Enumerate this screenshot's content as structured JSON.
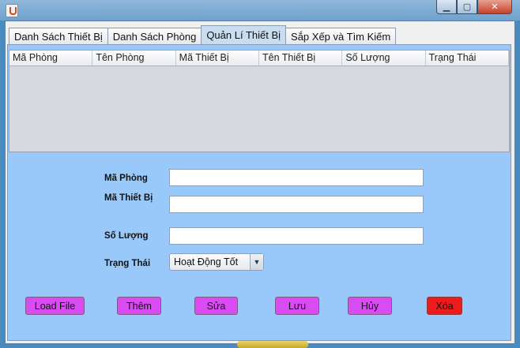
{
  "window": {
    "minimize_icon": "minimize-icon",
    "maximize_icon": "maximize-icon",
    "close_icon": "close-icon"
  },
  "tabs": [
    {
      "label": "Danh Sách Thiết Bị"
    },
    {
      "label": "Danh Sách Phòng"
    },
    {
      "label": "Quản Lí Thiết Bị"
    },
    {
      "label": "Sắp Xếp và Tìm Kiếm"
    }
  ],
  "table": {
    "columns": [
      "Mã Phòng",
      "Tên Phòng",
      "Mã Thiết Bị",
      "Tên Thiết Bị",
      "Số Lượng",
      "Trạng Thái"
    ]
  },
  "form": {
    "ma_phong_label": "Mã Phòng",
    "ma_thiet_bi_label": "Mã Thiết Bị",
    "so_luong_label": "Số Lượng",
    "trang_thai_label": "Trạng Thái",
    "ma_phong_value": "",
    "ma_thiet_bi_value": "",
    "so_luong_value": "",
    "trang_thai_selected": "Hoạt Động Tốt"
  },
  "buttons": {
    "load": "Load File",
    "them": "Thêm",
    "sua": "Sửa",
    "luu": "Lưu",
    "huy": "Hủy",
    "xoa": "Xóa"
  },
  "colors": {
    "panel_bg": "#99c9fb",
    "button": "#d94cf2",
    "delete_button": "#ec1c1c"
  }
}
